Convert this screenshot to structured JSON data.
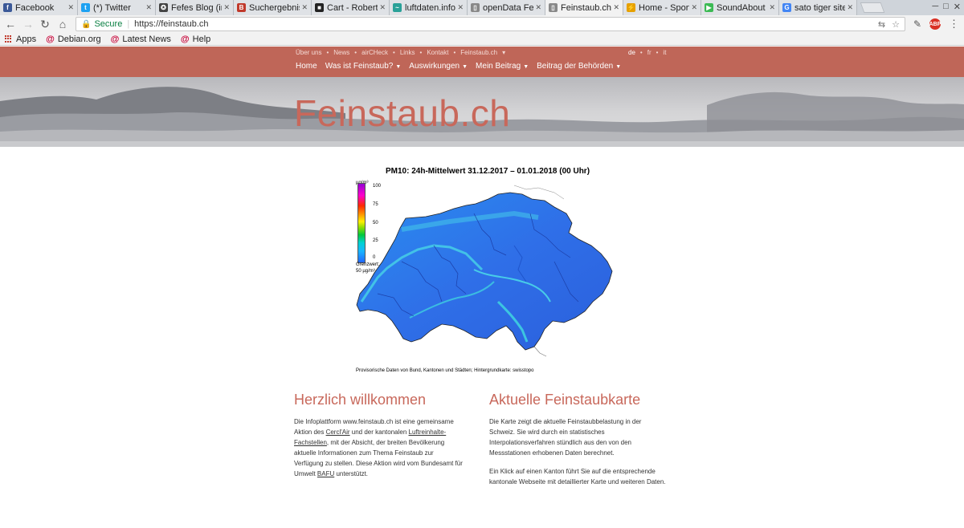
{
  "browser": {
    "tabs": [
      {
        "title": "Facebook",
        "color": "#3b5998",
        "glyph": "f"
      },
      {
        "title": "(*) Twitter",
        "color": "#1da1f2",
        "glyph": "t"
      },
      {
        "title": "Fefes Blog (inc",
        "color": "#444444",
        "glyph": "✪"
      },
      {
        "title": "Suchergebniss",
        "color": "#c0392b",
        "glyph": "B"
      },
      {
        "title": "Cart - Roberts",
        "color": "#222222",
        "glyph": "■"
      },
      {
        "title": "luftdaten.info -",
        "color": "#2aa198",
        "glyph": "~"
      },
      {
        "title": "openData Fein",
        "color": "#888888",
        "glyph": "▯"
      },
      {
        "title": "Feinstaub.ch -",
        "color": "#888888",
        "glyph": "▯",
        "active": true
      },
      {
        "title": "Home - Sports",
        "color": "#e6a000",
        "glyph": "⚡"
      },
      {
        "title": "SoundAbout -",
        "color": "#3cba54",
        "glyph": "▶"
      },
      {
        "title": "sato tiger site",
        "color": "#4285f4",
        "glyph": "G"
      }
    ],
    "address": {
      "secure_label": "Secure",
      "url": "https://feinstaub.ch"
    },
    "bookmarks": [
      {
        "label": "Apps"
      },
      {
        "label": "Debian.org"
      },
      {
        "label": "Latest News"
      },
      {
        "label": "Help"
      }
    ]
  },
  "site": {
    "meta_nav": [
      "Über uns",
      "News",
      "airCHeck",
      "Links",
      "Kontakt",
      "Feinstaub.ch"
    ],
    "languages": [
      "de",
      "fr",
      "it"
    ],
    "main_menu": [
      {
        "label": "Home",
        "dropdown": false
      },
      {
        "label": "Was ist Feinstaub?",
        "dropdown": true
      },
      {
        "label": "Auswirkungen",
        "dropdown": true
      },
      {
        "label": "Mein Beitrag",
        "dropdown": true
      },
      {
        "label": "Beitrag der Behörden",
        "dropdown": true
      }
    ],
    "title": "Feinstaub.ch",
    "accent_color": "#c8685b",
    "nav_color": "#bf6658"
  },
  "map": {
    "title": "PM10: 24h-Mittelwert 31.12.2017 – 01.01.2018 (00 Uhr)",
    "legend_unit": "µg/m³",
    "legend_ticks": [
      "100",
      "75",
      "50",
      "25",
      "0"
    ],
    "legend_note_1": "Grenzwert:",
    "legend_note_2": "50 µg/m³",
    "caption": "Provisorische Daten von Bund, Kantonen und Städten; Hintergrundkarte: swisstopo"
  },
  "welcome": {
    "heading": "Herzlich willkommen",
    "p1_before": "Die Infoplattform www.feinstaub.ch ist eine gemeinsame Aktion des ",
    "link_cercl": "Cercl'Air",
    "p1_middle": " und der kantonalen ",
    "link_fachstellen": "Luftreinhalte-Fachstellen",
    "p1_after": ", mit der Absicht, der breiten Bevölkerung aktuelle Informationen zum Thema Feinstaub zur Verfügung zu stellen. Diese Aktion wird vom Bundesamt für Umwelt ",
    "link_bafu": "BAFU",
    "p1_end": " unterstützt."
  },
  "current_map": {
    "heading": "Aktuelle Feinstaubkarte",
    "p1": "Die Karte zeigt die aktuelle Feinstaubbelastung in der Schweiz. Sie wird durch ein statistisches Interpolationsverfahren stündlich aus den von den Messstationen erhobenen Daten berechnet.",
    "p2": "Ein Klick auf einen Kanton führt Sie auf die entsprechende kantonale Webseite mit detaillierter Karte und weiteren Daten."
  }
}
